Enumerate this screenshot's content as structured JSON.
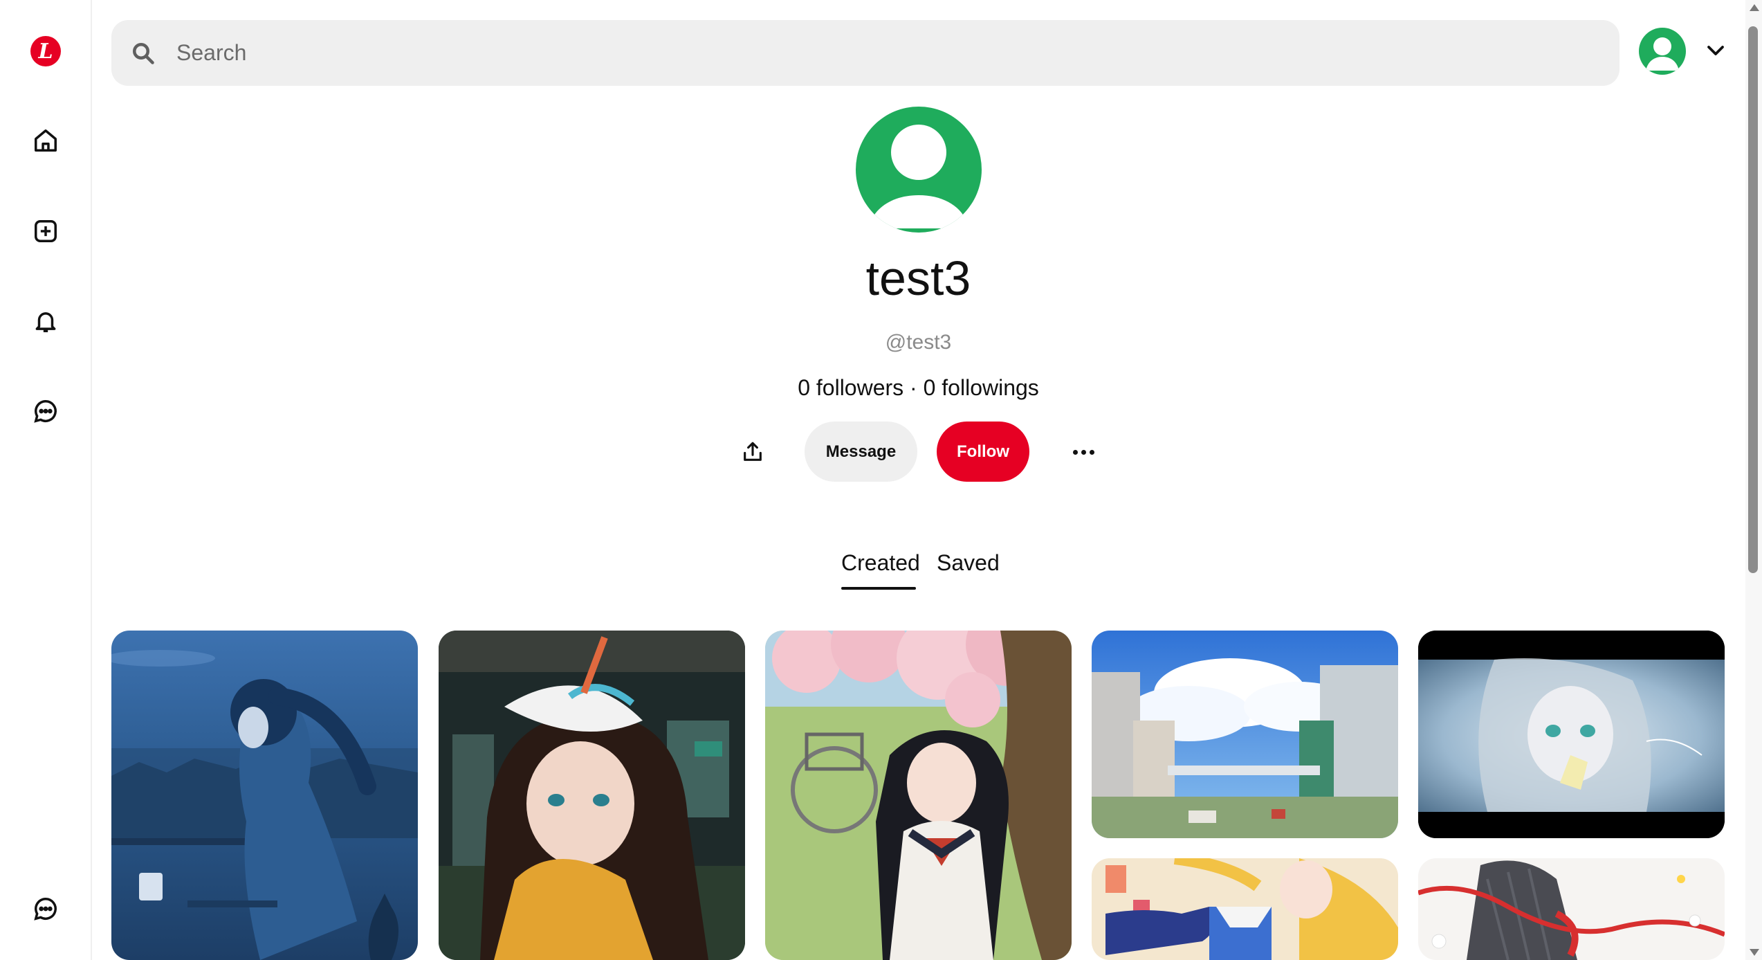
{
  "sidebar": {
    "logo_letter": "L",
    "items": [
      {
        "name": "home-icon"
      },
      {
        "name": "create-icon"
      },
      {
        "name": "notifications-icon"
      },
      {
        "name": "messages-icon"
      }
    ],
    "bottom_icon": "help-chat-icon"
  },
  "search": {
    "placeholder": "Search",
    "value": ""
  },
  "profile": {
    "display_name": "test3",
    "handle": "@test3",
    "stats": "0 followers · 0 followings",
    "avatar_color": "#1fac5c"
  },
  "actions": {
    "share_icon": "share-icon",
    "message_label": "Message",
    "follow_label": "Follow",
    "more_icon": "more-icon"
  },
  "tabs": [
    {
      "label": "Created",
      "active": true
    },
    {
      "label": "Saved",
      "active": false
    }
  ],
  "colors": {
    "brand": "#e60023",
    "avatar": "#1fac5c",
    "surface": "#efefef"
  },
  "pins": [
    {
      "name": "anime-girl-balcony-blue-dusk"
    },
    {
      "name": "anime-girl-white-hat-train"
    },
    {
      "name": "anime-girl-cherry-blossom-bicycle"
    },
    {
      "name": "anime-city-blue-sky"
    },
    {
      "name": "anime-girl-silver-hair-sparkle"
    },
    {
      "name": "anime-girl-orange-hair-playing-cards"
    },
    {
      "name": "anime-girl-gray-skirt-red-ribbon"
    }
  ]
}
